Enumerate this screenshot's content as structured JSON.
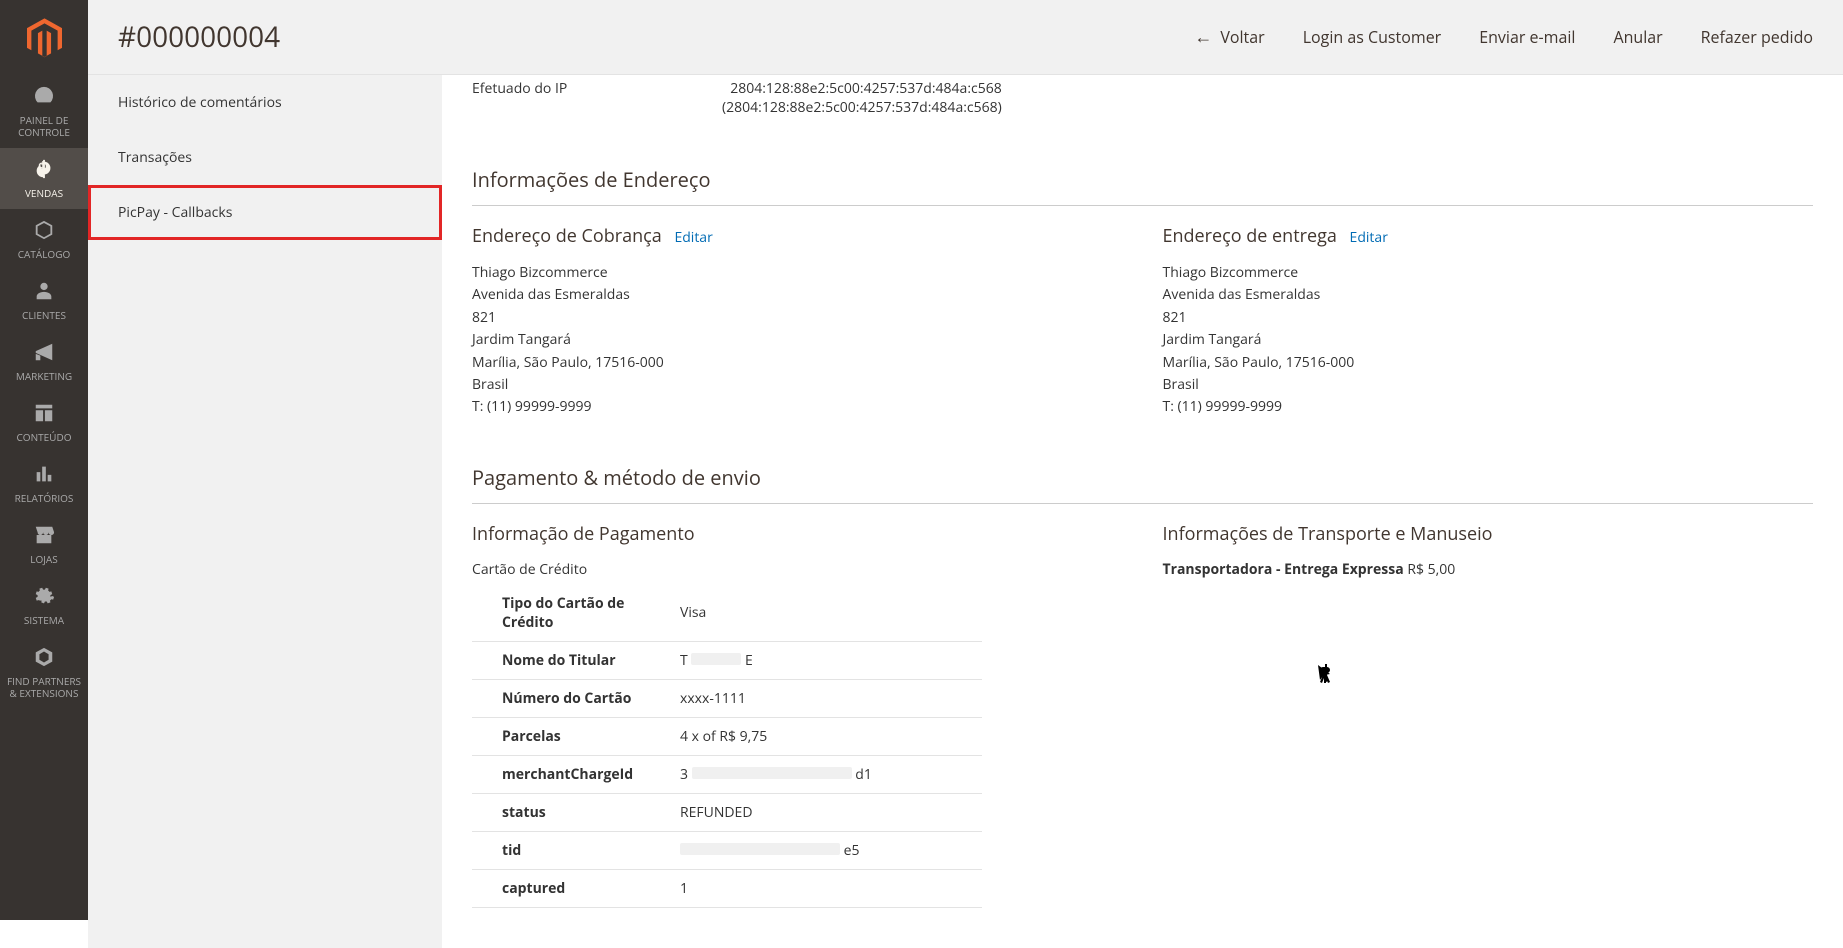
{
  "header": {
    "title": "#000000004",
    "actions": {
      "back": "Voltar",
      "login_as_customer": "Login as Customer",
      "send_email": "Enviar e-mail",
      "void": "Anular",
      "reorder": "Refazer pedido"
    }
  },
  "nav": {
    "dashboard": "Painel de Controle",
    "sales": "Vendas",
    "catalog": "Catálogo",
    "customers": "Clientes",
    "marketing": "Marketing",
    "content": "Conteúdo",
    "reports": "Relatórios",
    "stores": "Lojas",
    "system": "Sistema",
    "partners": "Find Partners & Extensions"
  },
  "side_tabs": {
    "comments": "Histórico de comentários",
    "transactions": "Transações",
    "picpay": "PicPay - Callbacks"
  },
  "ip_block": {
    "label": "Efetuado do IP",
    "value": "2804:128:88e2:5c00:4257:537d:484a:c568 (2804:128:88e2:5c00:4257:537d:484a:c568)"
  },
  "address_section": {
    "title": "Informações de Endereço",
    "billing_title": "Endereço de Cobrança",
    "shipping_title": "Endereço de entrega",
    "edit": "Editar",
    "billing": {
      "name": "Thiago Bizcommerce",
      "street": "Avenida das Esmeraldas",
      "number": "821",
      "district": "Jardim Tangará",
      "city_state_zip": "Marília, São Paulo, 17516-000",
      "country": "Brasil",
      "phone": "T: (11) 99999-9999"
    },
    "shipping": {
      "name": "Thiago Bizcommerce",
      "street": "Avenida das Esmeraldas",
      "number": "821",
      "district": "Jardim Tangará",
      "city_state_zip": "Marília, São Paulo, 17516-000",
      "country": "Brasil",
      "phone": "T: (11) 99999-9999"
    }
  },
  "payment_section": {
    "title": "Pagamento & método de envio",
    "pay_info_title": "Informação de Pagamento",
    "ship_info_title": "Informações de Transporte e Manuseio",
    "method_label": "Cartão de Crédito",
    "rows": {
      "card_type_label": "Tipo do Cartão de Crédito",
      "card_type_value": "Visa",
      "holder_label": "Nome do Titular",
      "holder_prefix": "T",
      "holder_suffix": "E",
      "card_number_label": "Número do Cartão",
      "card_number_value": "xxxx-1111",
      "installments_label": "Parcelas",
      "installments_value": "4 x of R$ 9,75",
      "merchant_label": "merchantChargeId",
      "merchant_prefix": "3",
      "merchant_suffix": "d1",
      "status_label": "status",
      "status_value": "REFUNDED",
      "tid_label": "tid",
      "tid_suffix": "e5",
      "captured_label": "captured",
      "captured_value": "1"
    },
    "shipping": {
      "carrier": "Transportadora - Entrega Expressa",
      "price": "R$ 5,00"
    }
  }
}
